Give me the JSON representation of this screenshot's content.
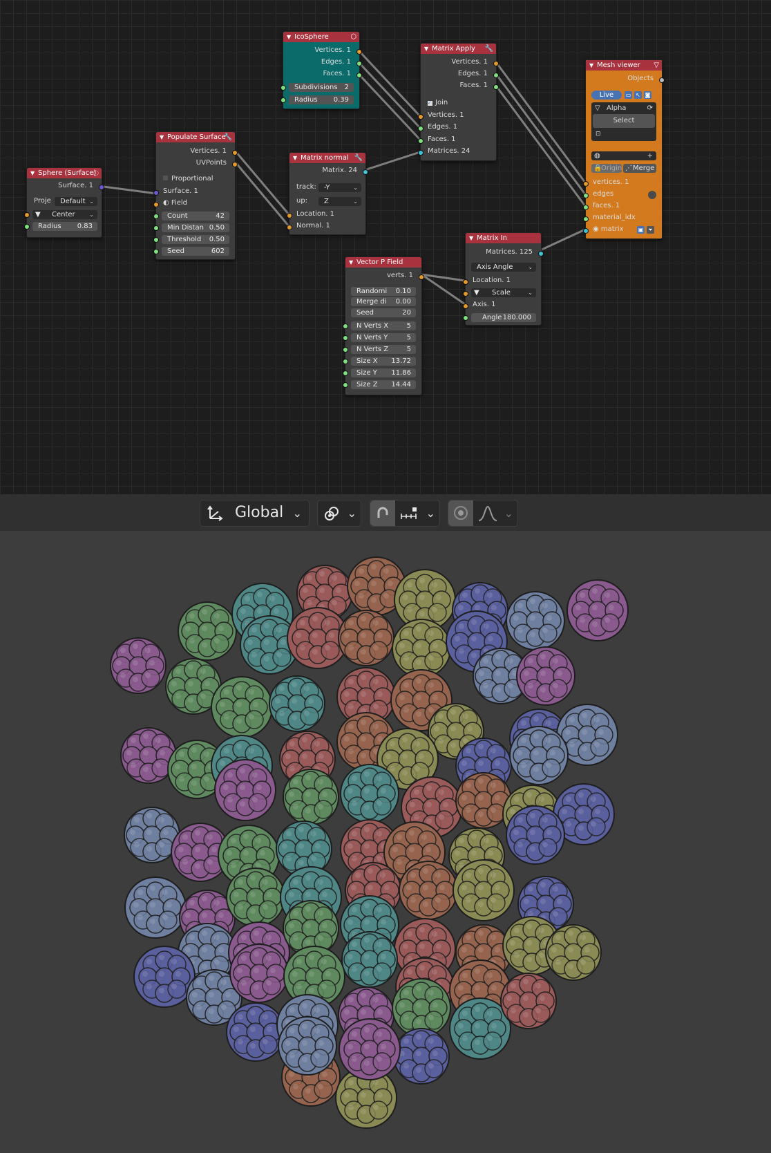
{
  "nodes": {
    "sphere": {
      "title": "Sphere (Surface)",
      "out_surface": "Surface. 1",
      "proj_label": "Proje",
      "proj_value": "Default",
      "center_value": "Center",
      "radius_label": "Radius",
      "radius_value": "0.83"
    },
    "populate": {
      "title": "Populate Surface",
      "out_vertices": "Vertices. 1",
      "out_uvpoints": "UVPoints",
      "proportional": "Proportional",
      "in_surface": "Surface. 1",
      "in_field": "Field",
      "count_label": "Count",
      "count_value": "42",
      "min_label": "Min Distan",
      "min_value": "0.50",
      "threshold_label": "Threshold",
      "threshold_value": "0.50",
      "seed_label": "Seed",
      "seed_value": "602"
    },
    "icosphere": {
      "title": "IcoSphere",
      "out_vertices": "Vertices. 1",
      "out_edges": "Edges. 1",
      "out_faces": "Faces. 1",
      "subdiv_label": "Subdivisions",
      "subdiv_value": "2",
      "radius_label": "Radius",
      "radius_value": "0.39"
    },
    "matrix_normal": {
      "title": "Matrix normal",
      "out_matrix": "Matrix. 24",
      "track_label": "track:",
      "track_value": "-Y",
      "up_label": "up:",
      "up_value": "Z",
      "in_location": "Location. 1",
      "in_normal": "Normal. 1"
    },
    "matrix_apply": {
      "title": "Matrix Apply",
      "out_vertices": "Vertices. 1",
      "out_edges": "Edges. 1",
      "out_faces": "Faces. 1",
      "join": "Join",
      "in_vertices": "Vertices. 1",
      "in_edges": "Edges. 1",
      "in_faces": "Faces. 1",
      "in_matrices": "Matrices. 24"
    },
    "mesh_viewer": {
      "title": "Mesh viewer",
      "out_objects": "Objects",
      "live": "Live",
      "material": "Alpha",
      "select": "Select",
      "origin": "Origin",
      "merge": "Merge",
      "in_vertices": "vertices. 1",
      "in_edges": "edges",
      "in_faces": "faces. 1",
      "in_material_idx": "material_idx",
      "in_matrix": "matrix"
    },
    "matrix_in": {
      "title": "Matrix In",
      "out_matrices": "Matrices. 125",
      "mode": "Axis Angle",
      "in_location": "Location. 1",
      "scale": "Scale",
      "in_axis": "Axis. 1",
      "angle_label": "Angle",
      "angle_value": "180.000"
    },
    "vector_field": {
      "title": "Vector P Field",
      "out_verts": "verts. 1",
      "random_label": "Randomi",
      "random_value": "0.10",
      "merge_label": "Merge di",
      "merge_value": "0.00",
      "seed_label": "Seed",
      "seed_value": "20",
      "nx_label": "N Verts X",
      "nx_value": "5",
      "ny_label": "N Verts Y",
      "ny_value": "5",
      "nz_label": "N Verts Z",
      "nz_value": "5",
      "sx_label": "Size X",
      "sx_value": "13.72",
      "sy_label": "Size Y",
      "sy_value": "11.86",
      "sz_label": "Size Z",
      "sz_value": "14.44"
    }
  },
  "toolbar": {
    "orientation": "Global",
    "orientation_icon": "transform-orientation-icon",
    "pivot_icon": "pivot-point-icon",
    "snap_icon": "snap-magnet-icon",
    "snap_target_icon": "snap-increment-icon",
    "proportional_icon": "proportional-editing-icon",
    "falloff_icon": "falloff-curve-icon"
  },
  "colors": {
    "node_header": "#a8323e",
    "icosphere_body": "#0b6a6a",
    "viewer_body": "#d47a1e",
    "socket_vertices": "#e39a2b",
    "socket_number": "#7fe07f",
    "socket_matrix": "#41c4d8",
    "socket_surface": "#6b59d8",
    "cluster_palette": [
      "#5f8a5f",
      "#5a5f9e",
      "#9a5a5a",
      "#8a5a8e",
      "#8a8a55",
      "#4f8787",
      "#6f7fa0",
      "#96644e"
    ]
  }
}
